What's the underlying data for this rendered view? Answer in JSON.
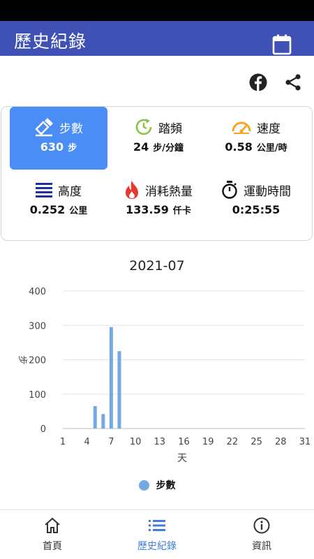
{
  "app_bar": {
    "title": "歷史紀錄",
    "calendar_icon": "calendar-icon"
  },
  "actions": {
    "facebook_icon": "facebook-icon",
    "share_icon": "share-icon"
  },
  "stats": [
    {
      "id": "steps",
      "label": "步數",
      "value": "630",
      "unit": "步",
      "icon": "pen-ruler-icon",
      "selected": true
    },
    {
      "id": "cadence",
      "label": "踏頻",
      "value": "24",
      "unit": "步/分鐘",
      "icon": "clock-refresh-icon",
      "selected": false
    },
    {
      "id": "speed",
      "label": "速度",
      "value": "0.58",
      "unit": "公里/時",
      "icon": "speedometer-icon",
      "selected": false
    },
    {
      "id": "height",
      "label": "高度",
      "value": "0.252",
      "unit": "公里",
      "icon": "bars-icon",
      "selected": false
    },
    {
      "id": "calories",
      "label": "消耗熱量",
      "value": "133.59",
      "unit": "仟卡",
      "icon": "flame-icon",
      "selected": false
    },
    {
      "id": "duration",
      "label": "運動時間",
      "value": "0:25:55",
      "unit": "",
      "icon": "stopwatch-icon",
      "selected": false
    }
  ],
  "colors": {
    "app_bar": "#3f51b5",
    "selected_card": "#4a8df5",
    "bar": "#74a9e2",
    "active_nav": "#3f7fd9"
  },
  "chart_data": {
    "type": "bar",
    "title": "2021-07",
    "xlabel": "天",
    "ylabel": "步",
    "x_ticks": [
      "1",
      "4",
      "7",
      "10",
      "13",
      "16",
      "19",
      "22",
      "25",
      "28",
      "31"
    ],
    "y_ticks": [
      "0",
      "100",
      "200",
      "300",
      "400"
    ],
    "ylim": [
      0,
      400
    ],
    "xlim": [
      1,
      31
    ],
    "grid": true,
    "legend_position": "bottom",
    "series": [
      {
        "name": "步數",
        "color": "#74a9e2",
        "x": [
          5,
          6,
          7,
          8
        ],
        "values": [
          65,
          42,
          295,
          225
        ]
      }
    ]
  },
  "bottom_nav": [
    {
      "label": "首頁",
      "icon": "home-icon",
      "active": false
    },
    {
      "label": "歷史紀錄",
      "icon": "list-icon",
      "active": true
    },
    {
      "label": "資訊",
      "icon": "info-icon",
      "active": false
    }
  ]
}
